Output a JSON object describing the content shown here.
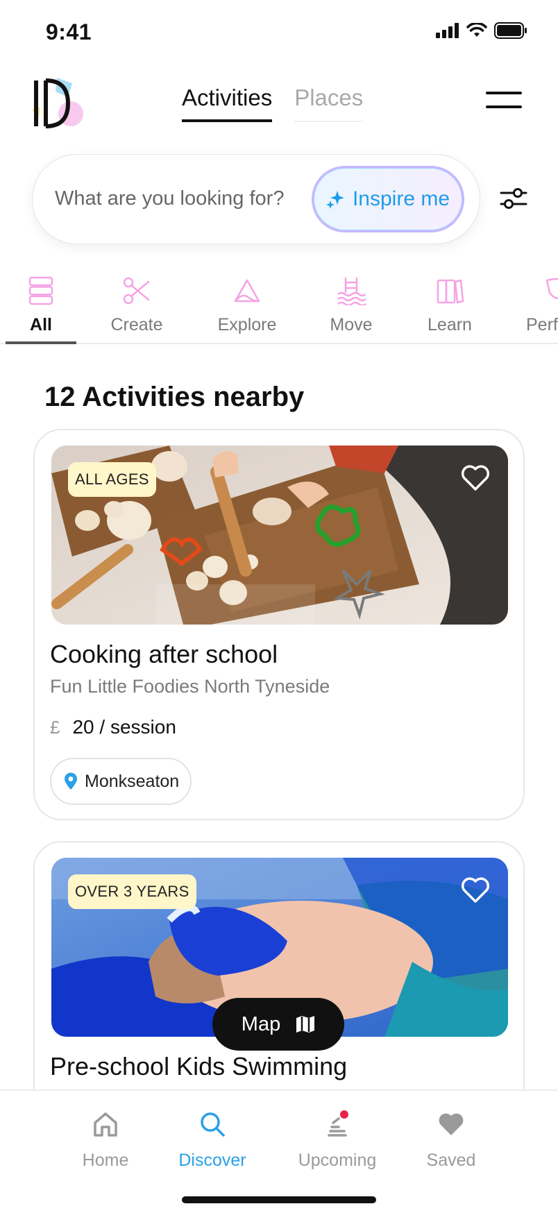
{
  "status_bar": {
    "time": "9:41"
  },
  "header": {
    "tabs": [
      {
        "label": "Activities",
        "active": true
      },
      {
        "label": "Places",
        "active": false
      }
    ]
  },
  "search": {
    "placeholder": "What are you looking for?",
    "inspire_label": "Inspire me"
  },
  "categories": [
    {
      "label": "All",
      "icon": "stack-icon",
      "active": true
    },
    {
      "label": "Create",
      "icon": "scissors-icon",
      "active": false
    },
    {
      "label": "Explore",
      "icon": "mountain-icon",
      "active": false
    },
    {
      "label": "Move",
      "icon": "swimming-icon",
      "active": false
    },
    {
      "label": "Learn",
      "icon": "books-icon",
      "active": false
    },
    {
      "label": "Perf",
      "icon": "masks-icon",
      "active": false
    }
  ],
  "section_title": "12 Activities nearby",
  "activities": [
    {
      "age": "ALL AGES",
      "title": "Cooking after school",
      "provider": "Fun Little Foodies North Tyneside",
      "currency": "£",
      "price": "20 / session",
      "location": "Monkseaton"
    },
    {
      "age": "OVER 3 YEARS",
      "title": "Pre-school Kids Swimming"
    }
  ],
  "map_button": {
    "label": "Map"
  },
  "bottom_nav": [
    {
      "label": "Home",
      "icon": "home-icon",
      "active": false
    },
    {
      "label": "Discover",
      "icon": "search-icon",
      "active": true
    },
    {
      "label": "Upcoming",
      "icon": "upcoming-icon",
      "active": false
    },
    {
      "label": "Saved",
      "icon": "heart-icon",
      "active": false
    }
  ],
  "colors": {
    "accent_blue": "#2aa0e6",
    "category_pink": "#f5a3e4",
    "badge_yellow": "#fff6c9",
    "notification_red": "#e8234b"
  }
}
